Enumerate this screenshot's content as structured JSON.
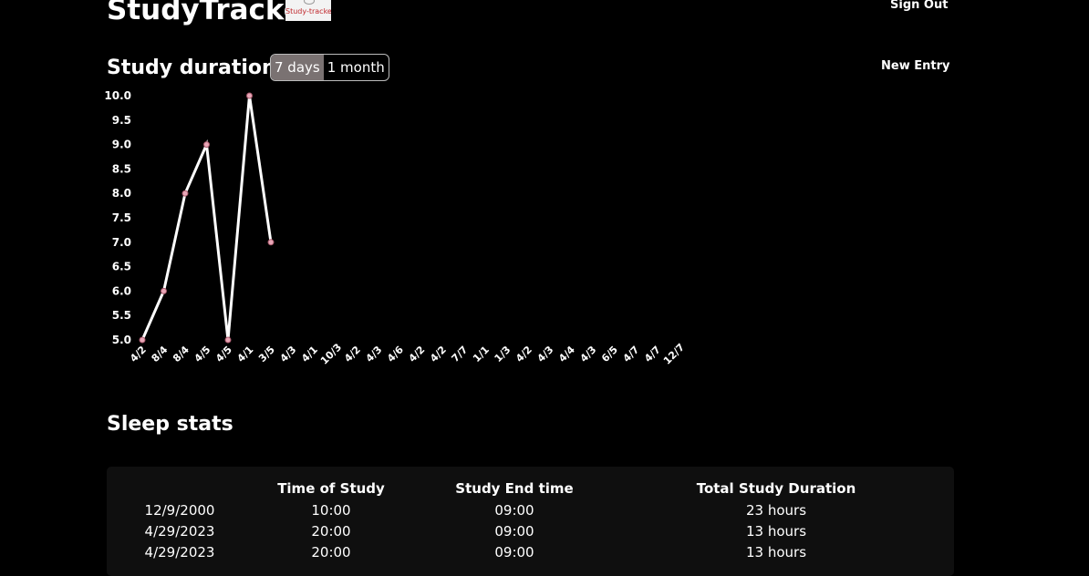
{
  "header": {
    "app_title": "StudyTracker",
    "logo_text": "Study-tracker",
    "sign_out_label": "Sign Out"
  },
  "study": {
    "title": "Study duration",
    "toggle": [
      "7 days",
      "1 month"
    ],
    "active_toggle": "7 days",
    "new_entry_label": "New Entry"
  },
  "chart_data": {
    "type": "line",
    "x": [
      "4/2",
      "8/4",
      "8/4",
      "4/5",
      "4/5",
      "4/1",
      "3/5",
      "4/3",
      "4/1",
      "10/3",
      "4/2",
      "4/3",
      "4/6",
      "4/2",
      "4/2",
      "7/7",
      "1/1",
      "1/3",
      "4/2",
      "4/3",
      "4/4",
      "4/3",
      "6/5",
      "4/7",
      "4/7",
      "12/7"
    ],
    "series": [
      {
        "values": [
          5.0,
          6.0,
          8.0,
          9.0,
          5.0,
          10.0,
          7.0
        ]
      }
    ],
    "yticks": [
      "10.0",
      "9.5",
      "9.0",
      "8.5",
      "8.0",
      "7.5",
      "7.0",
      "6.5",
      "6.0",
      "5.5",
      "5.0"
    ],
    "ylim": [
      5.0,
      10.0
    ],
    "grid": false,
    "line_color": "#ffffff",
    "point_color": "#e8a6b6"
  },
  "sleep": {
    "title": "Sleep stats",
    "columns": [
      "",
      "Time of Study",
      "Study End time",
      "Total Study Duration"
    ],
    "rows": [
      [
        "12/9/2000",
        "10:00",
        "09:00",
        "23 hours"
      ],
      [
        "4/29/2023",
        "20:00",
        "09:00",
        "13 hours"
      ],
      [
        "4/29/2023",
        "20:00",
        "09:00",
        "13 hours"
      ]
    ]
  }
}
